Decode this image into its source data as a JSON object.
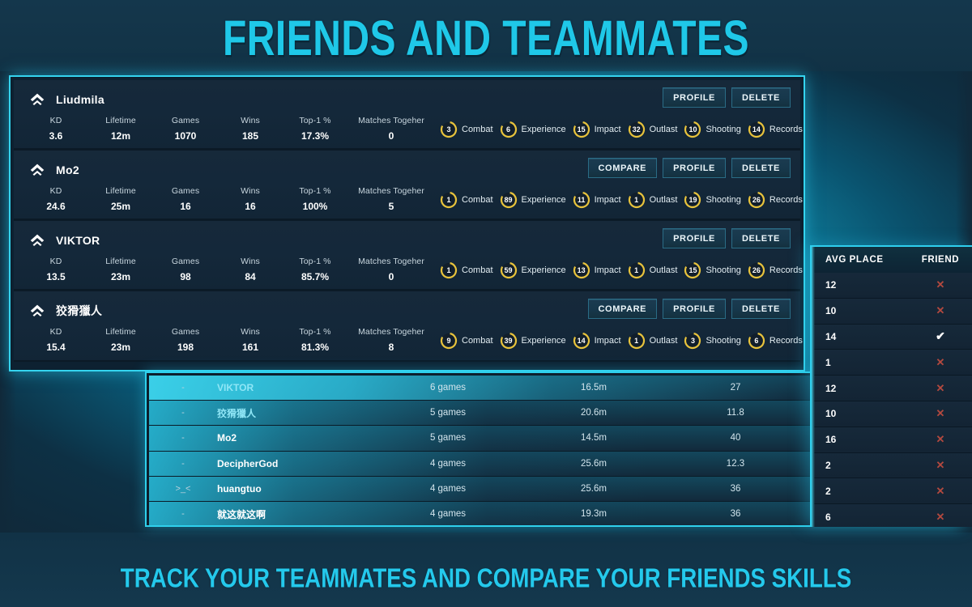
{
  "hero": {
    "title": "FRIENDS AND TEAMMATES",
    "subtitle": "TRACK YOUR TEAMMATES AND COMPARE YOUR FRIENDS SKILLS"
  },
  "colors": {
    "accent": "#1fc8e8",
    "panel_border": "#35d4ef",
    "badge_ring": "#e8c33c",
    "mark_x": "#b3493f",
    "background": "#123447"
  },
  "friends_panel": {
    "stat_labels": [
      "KD",
      "Lifetime",
      "Games",
      "Wins",
      "Top-1 %",
      "Matches Togeher"
    ],
    "badge_labels": [
      "Combat",
      "Experience",
      "Impact",
      "Outlast",
      "Shooting",
      "Records"
    ],
    "buttons": {
      "compare": "COMPARE",
      "profile": "PROFILE",
      "delete": "DELETE"
    },
    "rows": [
      {
        "name": "Liudmila",
        "rank_icon": "chevron-up-rank-icon",
        "has_compare": false,
        "stats": [
          "3.6",
          "12m",
          "1070",
          "185",
          "17.3%",
          "0"
        ],
        "badges": [
          3,
          6,
          15,
          32,
          10,
          14
        ]
      },
      {
        "name": "Mo2",
        "rank_icon": "chevron-up-rank-icon",
        "has_compare": true,
        "stats": [
          "24.6",
          "25m",
          "16",
          "16",
          "100%",
          "5"
        ],
        "badges": [
          1,
          89,
          11,
          1,
          19,
          26
        ]
      },
      {
        "name": "VIKTOR",
        "rank_icon": "chevron-up-rank-icon",
        "has_compare": false,
        "stats": [
          "13.5",
          "23m",
          "98",
          "84",
          "85.7%",
          "0"
        ],
        "badges": [
          1,
          59,
          13,
          1,
          15,
          26
        ]
      },
      {
        "name": "狡猾獵人",
        "rank_icon": "chevron-up-rank-icon",
        "has_compare": true,
        "stats": [
          "15.4",
          "23m",
          "198",
          "161",
          "81.3%",
          "8"
        ],
        "badges": [
          9,
          39,
          14,
          1,
          3,
          6
        ]
      }
    ]
  },
  "matches_table": {
    "rows": [
      {
        "emoji": "-",
        "name": "VIKTOR",
        "games": "6 games",
        "time": "16.5m",
        "kd": "27",
        "highlight": true,
        "accent_name": true
      },
      {
        "emoji": "-",
        "name": "狡猾獵人",
        "games": "5 games",
        "time": "20.6m",
        "kd": "11.8",
        "highlight": false,
        "accent_name": true
      },
      {
        "emoji": "-",
        "name": "Mo2",
        "games": "5 games",
        "time": "14.5m",
        "kd": "40",
        "highlight": false,
        "accent_name": false
      },
      {
        "emoji": "-",
        "name": "DecipherGod",
        "games": "4 games",
        "time": "25.6m",
        "kd": "12.3",
        "highlight": false,
        "accent_name": false
      },
      {
        "emoji": ">_<",
        "name": "huangtuo",
        "games": "4 games",
        "time": "25.6m",
        "kd": "36",
        "highlight": false,
        "accent_name": false
      },
      {
        "emoji": "-",
        "name": "就这就这啊",
        "games": "4 games",
        "time": "19.3m",
        "kd": "36",
        "highlight": false,
        "accent_name": false
      }
    ]
  },
  "right_panel": {
    "headers": {
      "avg_place": "AVG PLACE",
      "friend": "FRIEND"
    },
    "rows": [
      {
        "avg_place": "12",
        "friend": "x"
      },
      {
        "avg_place": "10",
        "friend": "x"
      },
      {
        "avg_place": "14",
        "friend": "check"
      },
      {
        "avg_place": "1",
        "friend": "x"
      },
      {
        "avg_place": "12",
        "friend": "x"
      },
      {
        "avg_place": "10",
        "friend": "x"
      },
      {
        "avg_place": "16",
        "friend": "x"
      },
      {
        "avg_place": "2",
        "friend": "x"
      },
      {
        "avg_place": "2",
        "friend": "x"
      },
      {
        "avg_place": "6",
        "friend": "x"
      }
    ],
    "marks": {
      "x": "✕",
      "check": "✔"
    }
  }
}
